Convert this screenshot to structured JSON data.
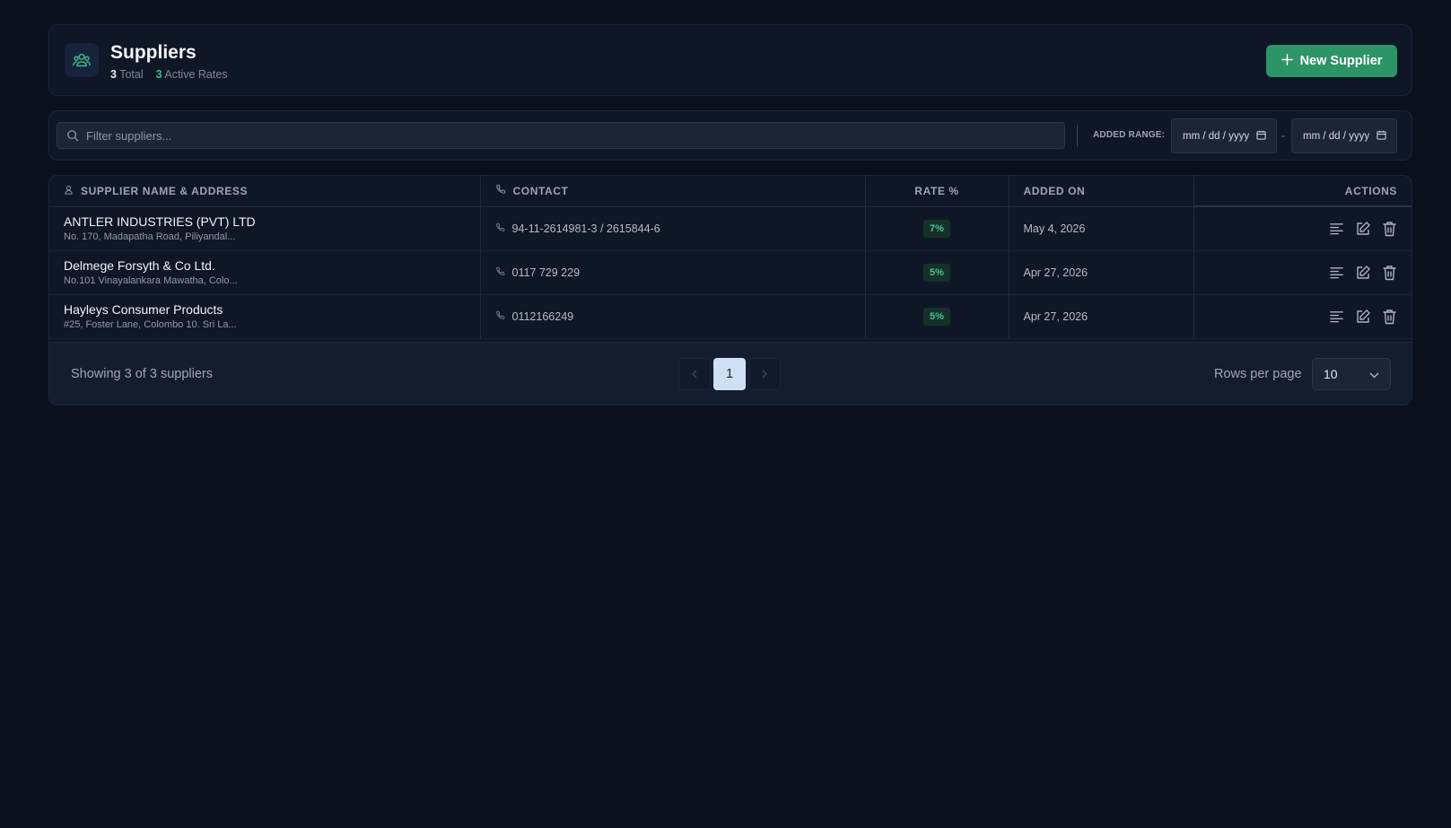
{
  "header": {
    "title": "Suppliers",
    "total_count": "3",
    "total_label": "Total",
    "active_count": "3",
    "active_label": "Active Rates",
    "new_button_label": "New Supplier"
  },
  "filter": {
    "search_placeholder": "Filter suppliers...",
    "range_label": "ADDED RANGE:",
    "date_from_placeholder": "mm / dd / yyyy",
    "date_to_placeholder": "mm / dd / yyyy",
    "range_separator": "-"
  },
  "table": {
    "columns": {
      "name": "SUPPLIER NAME & ADDRESS",
      "contact": "CONTACT",
      "rate": "RATE %",
      "added": "ADDED ON",
      "actions": "ACTIONS"
    },
    "rows": [
      {
        "name": "ANTLER INDUSTRIES (PVT) LTD",
        "address": "No. 170, Madapatha Road, Piliyandal...",
        "contact": "94-11-2614981-3 / 2615844-6",
        "rate": "7%",
        "added": "May 4, 2026"
      },
      {
        "name": "Delmege Forsyth & Co Ltd.",
        "address": "No.101 Vinayalankara Mawatha, Colo...",
        "contact": "0117 729 229",
        "rate": "5%",
        "added": "Apr 27, 2026"
      },
      {
        "name": "Hayleys Consumer Products",
        "address": "#25, Foster Lane, Colombo 10. Sri La...",
        "contact": "0112166249",
        "rate": "5%",
        "added": "Apr 27, 2026"
      }
    ]
  },
  "footer": {
    "showing_text": "Showing 3 of 3 suppliers",
    "current_page": "1",
    "rows_per_page_label": "Rows per page",
    "rows_per_page_value": "10"
  },
  "colors": {
    "accent": "#2d9467",
    "background": "#0a101c",
    "rate_badge": "#46c593"
  },
  "icons": {
    "logo": "users-icon",
    "new_button": "plus-icon",
    "search": "search-icon",
    "calendar": "calendar-icon",
    "name_column": "user-icon",
    "contact": "phone-icon",
    "view": "list-icon",
    "edit": "edit-icon",
    "delete": "trash-icon",
    "prev": "chevron-left-icon",
    "next": "chevron-right-icon",
    "select": "chevron-down-icon"
  }
}
